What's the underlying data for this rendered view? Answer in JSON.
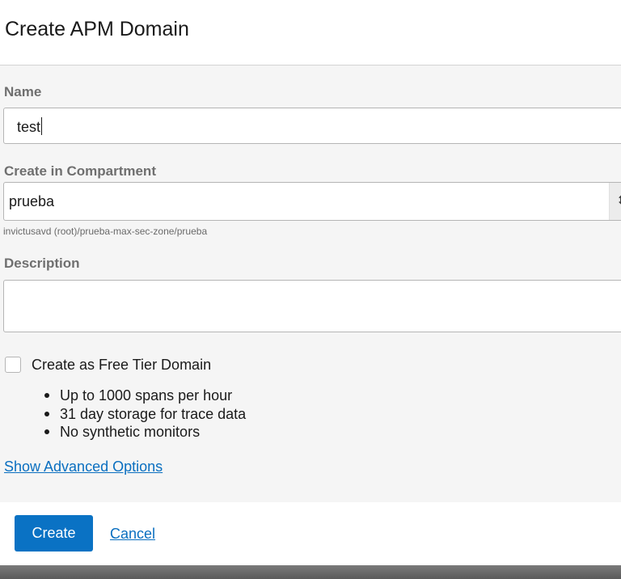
{
  "dialog": {
    "title": "Create APM Domain"
  },
  "form": {
    "name": {
      "label": "Name",
      "value": "test"
    },
    "compartment": {
      "label": "Create in Compartment",
      "value": "prueba",
      "path": "invictusavd (root)/prueba-max-sec-zone/prueba",
      "arrow": "⇕"
    },
    "description": {
      "label": "Description",
      "value": ""
    },
    "free_tier": {
      "label": "Create as Free Tier Domain",
      "checked": false,
      "bullets": [
        "Up to 1000 spans per hour",
        "31 day storage for trace data",
        "No synthetic monitors"
      ]
    },
    "advanced_link": "Show Advanced Options"
  },
  "footer": {
    "create_label": "Create",
    "cancel_label": "Cancel"
  },
  "colors": {
    "primary_button": "#0a72c4",
    "link": "#0a6fc0"
  }
}
